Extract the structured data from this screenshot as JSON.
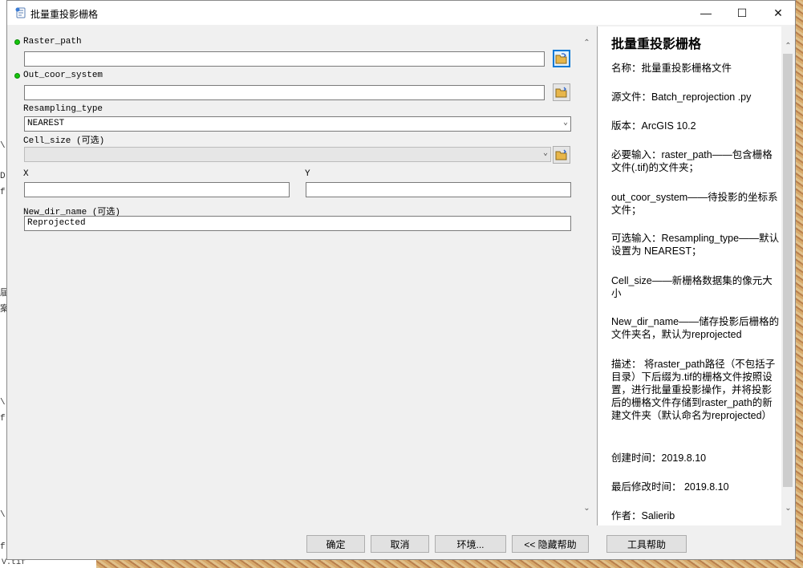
{
  "window": {
    "title": "批量重投影栅格",
    "min_glyph": "—",
    "max_glyph": "☐",
    "close_glyph": "✕"
  },
  "background": {
    "left_fragments": [
      "\\",
      "D",
      "f",
      "届",
      "案",
      "\\",
      "f",
      "\\",
      "f"
    ],
    "bottom_left_text": "V.tif"
  },
  "form": {
    "raster_path": {
      "label": "Raster_path",
      "value": ""
    },
    "out_coor_system": {
      "label": "Out_coor_system",
      "value": ""
    },
    "resampling_type": {
      "label": "Resampling_type",
      "value": "NEAREST"
    },
    "cell_size": {
      "label": "Cell_size (可选)",
      "value": ""
    },
    "x": {
      "label": "X",
      "value": ""
    },
    "y": {
      "label": "Y",
      "value": ""
    },
    "new_dir_name": {
      "label": "New_dir_name (可选)",
      "value": "Reprojected"
    }
  },
  "help": {
    "title": "批量重投影栅格",
    "paragraphs": [
      "名称：批量重投影栅格文件",
      "源文件：Batch_reprojection .py",
      "版本：ArcGIS 10.2",
      "必要输入：raster_path——包含栅格文件(.tif)的文件夹；",
      "out_coor_system——待投影的坐标系文件；",
      "可选输入：Resampling_type——默认设置为 NEAREST；",
      "Cell_size——新栅格数据集的像元大小",
      "New_dir_name——储存投影后栅格的文件夹名，默认为reprojected",
      "描述： 将raster_path路径（不包括子目录）下后缀为.tif的栅格文件按照设置，进行批量重投影操作，并将投影后的栅格文件存储到raster_path的新建文件夹（默认命名为reprojected）",
      "创建时间：2019.8.10",
      "最后修改时间： 2019.8.10",
      "作者：Salierib"
    ]
  },
  "buttons": {
    "ok": "确定",
    "cancel": "取消",
    "env": "环境...",
    "hide_help": "<< 隐藏帮助",
    "tool_help": "工具帮助"
  },
  "colors": {
    "required_dot": "#16c40d",
    "focus_border": "#0078d7",
    "folder_yellow": "#e8b64a"
  }
}
